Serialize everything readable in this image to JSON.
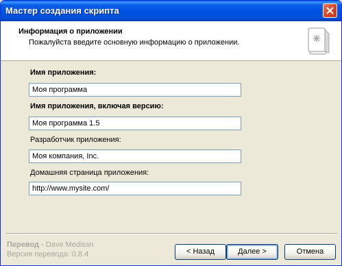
{
  "window": {
    "title": "Мастер создания скрипта"
  },
  "header": {
    "title": "Информация о приложении",
    "subtitle": "Пожалуйста введите основную информацию о приложении.",
    "icon": "script-wizard-icon"
  },
  "form": {
    "fields": [
      {
        "label": "Имя приложения:",
        "value": "Моя программа"
      },
      {
        "label": "Имя приложения, включая версию:",
        "value": "Моя программа 1.5"
      },
      {
        "label": "Разработчик приложения:",
        "value": "Моя компания, Inc."
      },
      {
        "label": "Домашняя страница приложения:",
        "value": "http://www.mysite.com/"
      }
    ]
  },
  "footer": {
    "translation_label": "Перевод",
    "translation_author": " - Dave Medissn",
    "translation_version": "Версия перевода: 0.8.4"
  },
  "buttons": {
    "back": "< Назад",
    "next": "Далее >",
    "cancel": "Отмена"
  },
  "colors": {
    "titlebar": "#0053e1",
    "dialog_bg": "#ece9d8",
    "input_border": "#7f9db9",
    "credit_text": "#a8a8a0"
  }
}
